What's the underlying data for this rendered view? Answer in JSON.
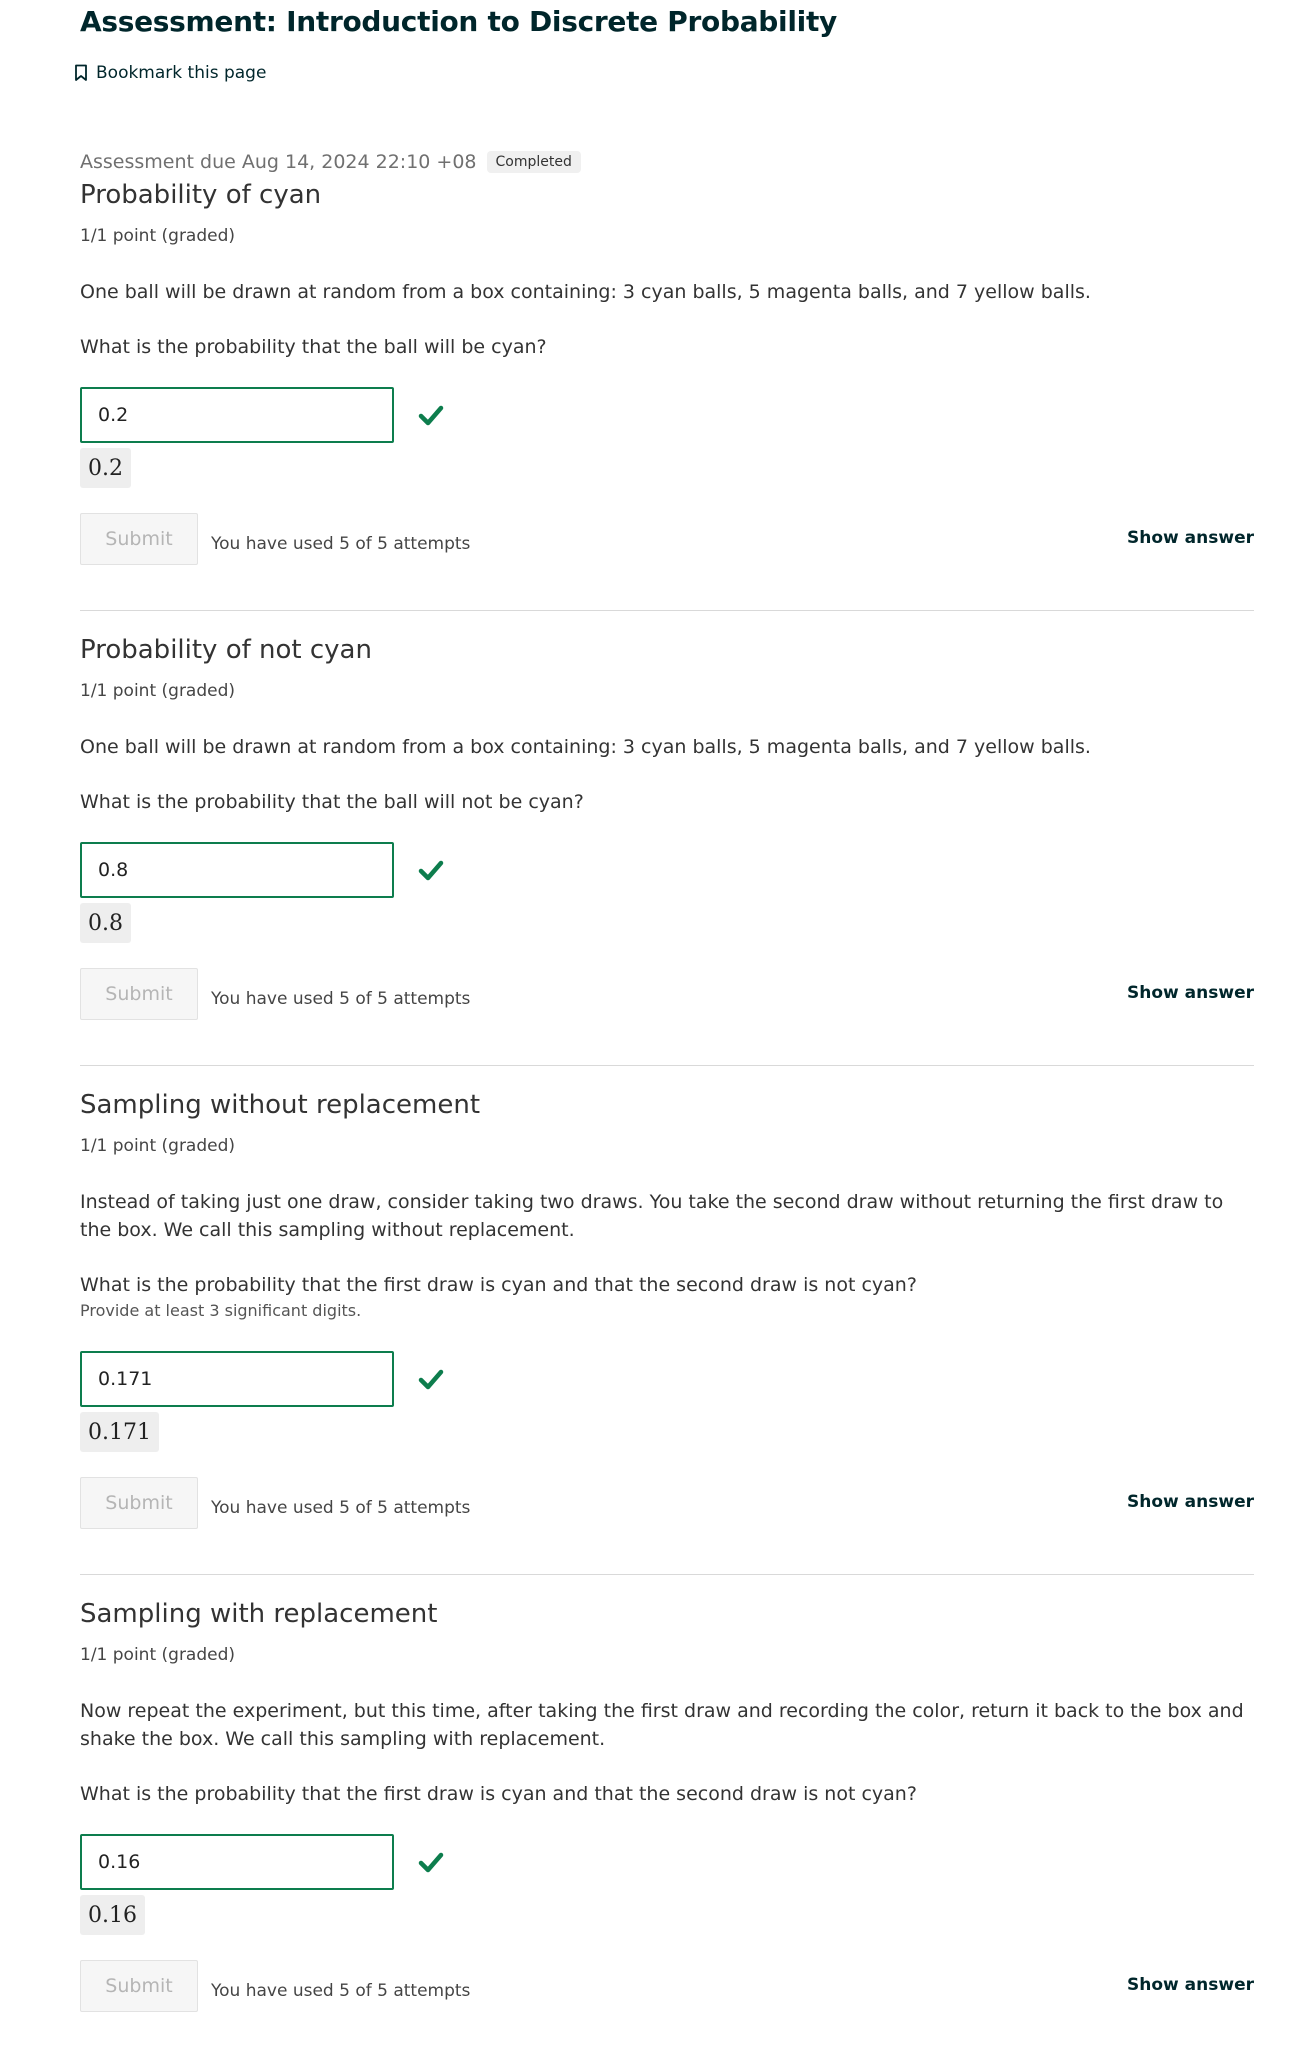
{
  "page": {
    "title": "Assessment: Introduction to Discrete Probability",
    "bookmark_label": "Bookmark this page",
    "due_text": "Assessment due Aug 14, 2024 22:10 +08",
    "status_badge": "Completed"
  },
  "problems": [
    {
      "title": "Probability of cyan",
      "points": "1/1 point (graded)",
      "body": "One ball will be drawn at random from a box containing: 3 cyan balls, 5 magenta balls, and 7 yellow balls.",
      "question": "What is the probability that the ball will be cyan?",
      "answer_value": "0.2",
      "preview": "0.2",
      "submit_label": "Submit",
      "attempts_text": "You have used 5 of 5 attempts",
      "show_answer_label": "Show answer"
    },
    {
      "title": "Probability of not cyan",
      "points": "1/1 point (graded)",
      "body": "One ball will be drawn at random from a box containing: 3 cyan balls, 5 magenta balls, and 7 yellow balls.",
      "question": "What is the probability that the ball will not be cyan?",
      "answer_value": "0.8",
      "preview": "0.8",
      "submit_label": "Submit",
      "attempts_text": "You have used 5 of 5 attempts",
      "show_answer_label": "Show answer"
    },
    {
      "title": "Sampling without replacement",
      "points": "1/1 point (graded)",
      "body": "Instead of taking just one draw, consider taking two draws. You take the second draw without returning the first draw to the box. We call this sampling without replacement.",
      "question": "What is the probability that the first draw is cyan and that the second draw is not cyan?",
      "hint": "Provide at least 3 significant digits.",
      "answer_value": "0.171",
      "preview": "0.171",
      "submit_label": "Submit",
      "attempts_text": "You have used 5 of 5 attempts",
      "show_answer_label": "Show answer"
    },
    {
      "title": "Sampling with replacement",
      "points": "1/1 point (graded)",
      "body": "Now repeat the experiment, but this time, after taking the first draw and recording the color, return it back to the box and shake the box. We call this sampling with replacement.",
      "question": "What is the probability that the first draw is cyan and that the second draw is not cyan?",
      "answer_value": "0.16",
      "preview": "0.16",
      "submit_label": "Submit",
      "attempts_text": "You have used 5 of 5 attempts",
      "show_answer_label": "Show answer"
    }
  ],
  "colors": {
    "title": "#00262b",
    "correct_green": "#0d7d4d",
    "input_border": "#0d7d4d",
    "divider": "#d9d9d9"
  },
  "icons": {
    "bookmark": "bookmark-icon",
    "correct": "checkmark-icon"
  }
}
